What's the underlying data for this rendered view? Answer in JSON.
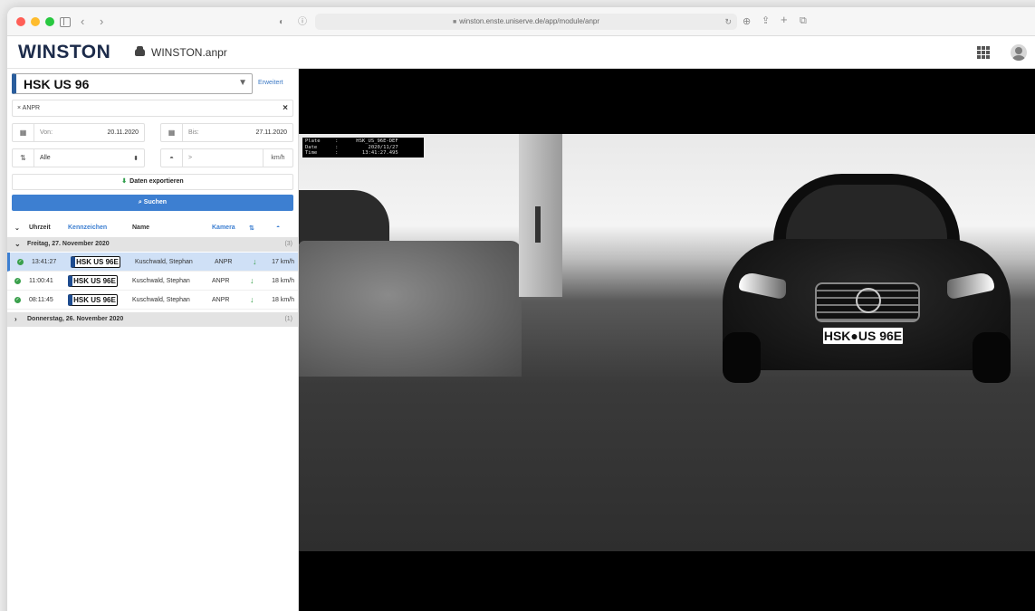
{
  "browser": {
    "url": "winston.enste.uniserve.de/app/module/anpr",
    "traffic_colors": [
      "#ff5f57",
      "#febc2e",
      "#28c840"
    ]
  },
  "app": {
    "logo": "WINSTON",
    "module": "WINSTON.anpr"
  },
  "search": {
    "plate": "HSK US 96",
    "advanced": "Erweitert",
    "tag": "ANPR",
    "from_label": "Von:",
    "from_value": "20.11.2020",
    "to_label": "Bis:",
    "to_value": "27.11.2020",
    "direction": "Alle",
    "speed_op": ">",
    "speed_unit": "km/h",
    "export": "Daten exportieren",
    "submit": "Suchen"
  },
  "table": {
    "headers": {
      "time": "Uhrzeit",
      "plate": "Kennzeichen",
      "name": "Name",
      "camera": "Kamera"
    },
    "groups": [
      {
        "label": "Freitag, 27. November 2020",
        "count": "(3)",
        "rows": [
          {
            "time": "13:41:27",
            "plate": "HSK US 96E",
            "name": "Kuschwald, Stephan",
            "camera": "ANPR",
            "speed": "17 km/h"
          },
          {
            "time": "11:00:41",
            "plate": "HSK US 96E",
            "name": "Kuschwald, Stephan",
            "camera": "ANPR",
            "speed": "18 km/h"
          },
          {
            "time": "08:11:45",
            "plate": "HSK US 96E",
            "name": "Kuschwald, Stephan",
            "camera": "ANPR",
            "speed": "18 km/h"
          }
        ]
      },
      {
        "label": "Donnerstag, 26. November 2020",
        "count": "(1)"
      }
    ]
  },
  "image": {
    "overlay": "Plate     :      HSK_US_96E-DEF\nDate      :          2020/11/27\nTime      :        13:41:27.495",
    "car_plate": "HSK●US 96E"
  },
  "colors": {
    "accent": "#3d7fd1",
    "success": "#3aa04c",
    "logo_orange": "#e8882a"
  }
}
